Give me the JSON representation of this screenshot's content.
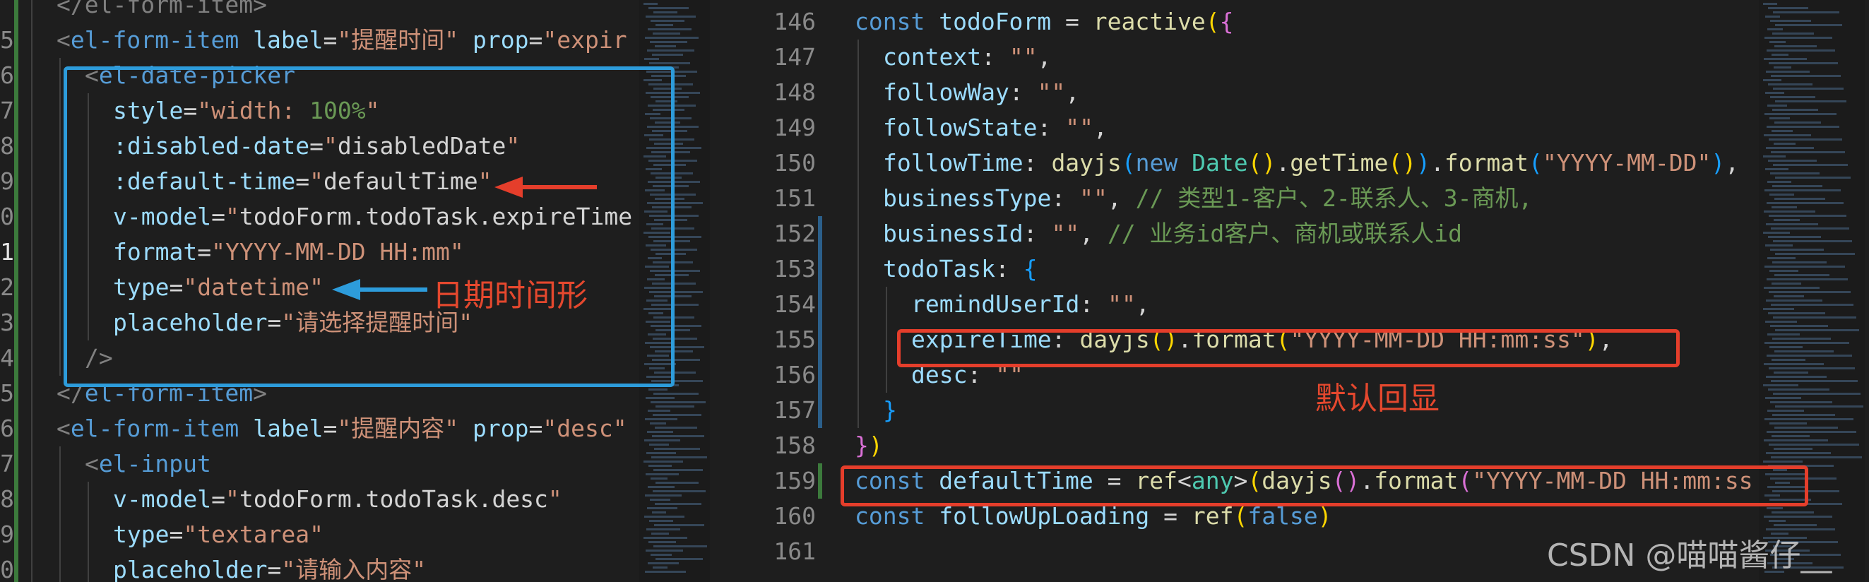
{
  "left_editor": {
    "lines": [
      {
        "num": "",
        "tokens": [
          [
            "t-gray",
            "</el-form-item>"
          ]
        ],
        "indent": 1
      },
      {
        "num": "5",
        "tokens": [
          [
            "t-gray",
            "<"
          ],
          [
            "t-tag",
            "el-form-item"
          ],
          [
            "t-punc",
            " "
          ],
          [
            "t-attr",
            "label"
          ],
          [
            "t-punc",
            "="
          ],
          [
            "t-str",
            "\"提醒时间\""
          ],
          [
            "t-punc",
            " "
          ],
          [
            "t-attr",
            "prop"
          ],
          [
            "t-punc",
            "="
          ],
          [
            "t-str",
            "\"expir"
          ]
        ],
        "indent": 1
      },
      {
        "num": "6",
        "tokens": [
          [
            "t-gray",
            "<"
          ],
          [
            "t-tag",
            "el-date-picker"
          ]
        ],
        "indent": 2
      },
      {
        "num": "7",
        "tokens": [
          [
            "t-attr",
            "style"
          ],
          [
            "t-punc",
            "="
          ],
          [
            "t-str",
            "\"width: "
          ],
          [
            "t-cmt",
            "100%"
          ],
          [
            "t-str",
            "\""
          ]
        ],
        "indent": 3
      },
      {
        "num": "8",
        "tokens": [
          [
            "t-attr",
            ":disabled-date"
          ],
          [
            "t-punc",
            "="
          ],
          [
            "t-str",
            "\""
          ],
          [
            "t-punc",
            "disabledDate"
          ],
          [
            "t-str",
            "\""
          ]
        ],
        "indent": 3
      },
      {
        "num": "9",
        "tokens": [
          [
            "t-attr",
            ":default-time"
          ],
          [
            "t-punc",
            "="
          ],
          [
            "t-str",
            "\""
          ],
          [
            "t-punc",
            "defaultTime"
          ],
          [
            "t-str",
            "\""
          ]
        ],
        "indent": 3
      },
      {
        "num": "0",
        "tokens": [
          [
            "t-attr",
            "v-model"
          ],
          [
            "t-punc",
            "="
          ],
          [
            "t-str",
            "\""
          ],
          [
            "t-punc",
            "todoForm.todoTask.expireTime"
          ]
        ],
        "indent": 3
      },
      {
        "num": "1",
        "tokens": [
          [
            "t-attr",
            "format"
          ],
          [
            "t-punc",
            "="
          ],
          [
            "t-str",
            "\"YYYY-MM-DD HH:mm\""
          ]
        ],
        "indent": 3,
        "active": true
      },
      {
        "num": "2",
        "tokens": [
          [
            "t-attr",
            "type"
          ],
          [
            "t-punc",
            "="
          ],
          [
            "t-str",
            "\"datetime\""
          ]
        ],
        "indent": 3
      },
      {
        "num": "3",
        "tokens": [
          [
            "t-attr",
            "placeholder"
          ],
          [
            "t-punc",
            "="
          ],
          [
            "t-str",
            "\"请选择提醒时间\""
          ]
        ],
        "indent": 3
      },
      {
        "num": "4",
        "tokens": [
          [
            "t-gray",
            "/>"
          ]
        ],
        "indent": 2
      },
      {
        "num": "5",
        "tokens": [
          [
            "t-gray",
            "</"
          ],
          [
            "t-tag",
            "el-form-item"
          ],
          [
            "t-gray",
            ">"
          ]
        ],
        "indent": 1
      },
      {
        "num": "6",
        "tokens": [
          [
            "t-gray",
            "<"
          ],
          [
            "t-tag",
            "el-form-item"
          ],
          [
            "t-punc",
            " "
          ],
          [
            "t-attr",
            "label"
          ],
          [
            "t-punc",
            "="
          ],
          [
            "t-str",
            "\"提醒内容\""
          ],
          [
            "t-punc",
            " "
          ],
          [
            "t-attr",
            "prop"
          ],
          [
            "t-punc",
            "="
          ],
          [
            "t-str",
            "\"desc\""
          ]
        ],
        "indent": 1
      },
      {
        "num": "7",
        "tokens": [
          [
            "t-gray",
            "<"
          ],
          [
            "t-tag",
            "el-input"
          ]
        ],
        "indent": 2
      },
      {
        "num": "8",
        "tokens": [
          [
            "t-attr",
            "v-model"
          ],
          [
            "t-punc",
            "="
          ],
          [
            "t-str",
            "\""
          ],
          [
            "t-punc",
            "todoForm.todoTask.desc"
          ],
          [
            "t-str",
            "\""
          ]
        ],
        "indent": 3
      },
      {
        "num": "9",
        "tokens": [
          [
            "t-attr",
            "type"
          ],
          [
            "t-punc",
            "="
          ],
          [
            "t-str",
            "\"textarea\""
          ]
        ],
        "indent": 3
      },
      {
        "num": "0",
        "tokens": [
          [
            "t-attr",
            "placeholder"
          ],
          [
            "t-punc",
            "="
          ],
          [
            "t-str",
            "\"请输入内容\""
          ]
        ],
        "indent": 3
      }
    ]
  },
  "right_editor": {
    "lines": [
      {
        "num": "146",
        "tokens": [
          [
            "t-kw",
            "const"
          ],
          [
            "t-punc",
            " "
          ],
          [
            "t-var",
            "todoForm"
          ],
          [
            "t-punc",
            " = "
          ],
          [
            "t-fn",
            "reactive"
          ],
          [
            "t-brk1",
            "("
          ],
          [
            "t-brk2",
            "{"
          ]
        ],
        "indent": 0
      },
      {
        "num": "147",
        "tokens": [
          [
            "t-var",
            "context"
          ],
          [
            "t-punc",
            ": "
          ],
          [
            "t-str",
            "\"\""
          ],
          [
            "t-punc",
            ","
          ]
        ],
        "indent": 1
      },
      {
        "num": "148",
        "tokens": [
          [
            "t-var",
            "followWay"
          ],
          [
            "t-punc",
            ": "
          ],
          [
            "t-str",
            "\"\""
          ],
          [
            "t-punc",
            ","
          ]
        ],
        "indent": 1
      },
      {
        "num": "149",
        "tokens": [
          [
            "t-var",
            "followState"
          ],
          [
            "t-punc",
            ": "
          ],
          [
            "t-str",
            "\"\""
          ],
          [
            "t-punc",
            ","
          ]
        ],
        "indent": 1
      },
      {
        "num": "150",
        "tokens": [
          [
            "t-var",
            "followTime"
          ],
          [
            "t-punc",
            ": "
          ],
          [
            "t-fn",
            "dayjs"
          ],
          [
            "t-brk3",
            "("
          ],
          [
            "t-kw",
            "new"
          ],
          [
            "t-punc",
            " "
          ],
          [
            "t-type",
            "Date"
          ],
          [
            "t-brk1",
            "()"
          ],
          [
            "t-punc",
            "."
          ],
          [
            "t-fn",
            "getTime"
          ],
          [
            "t-brk1",
            "()"
          ],
          [
            "t-brk3",
            ")"
          ],
          [
            "t-punc",
            "."
          ],
          [
            "t-fn",
            "format"
          ],
          [
            "t-brk3",
            "("
          ],
          [
            "t-str",
            "\"YYYY-MM-DD\""
          ],
          [
            "t-brk3",
            ")"
          ],
          [
            "t-punc",
            ","
          ]
        ],
        "indent": 1
      },
      {
        "num": "151",
        "tokens": [
          [
            "t-var",
            "businessType"
          ],
          [
            "t-punc",
            ": "
          ],
          [
            "t-str",
            "\"\""
          ],
          [
            "t-punc",
            ", "
          ],
          [
            "t-cmt",
            "// 类型1-客户、2-联系人、3-商机,"
          ]
        ],
        "indent": 1
      },
      {
        "num": "152",
        "tokens": [
          [
            "t-var",
            "businessId"
          ],
          [
            "t-punc",
            ": "
          ],
          [
            "t-str",
            "\"\""
          ],
          [
            "t-punc",
            ", "
          ],
          [
            "t-cmt",
            "// 业务id客户、商机或联系人id"
          ]
        ],
        "indent": 1
      },
      {
        "num": "153",
        "tokens": [
          [
            "t-var",
            "todoTask"
          ],
          [
            "t-punc",
            ": "
          ],
          [
            "t-brk3",
            "{"
          ]
        ],
        "indent": 1
      },
      {
        "num": "154",
        "tokens": [
          [
            "t-var",
            "remindUserId"
          ],
          [
            "t-punc",
            ": "
          ],
          [
            "t-str",
            "\"\""
          ],
          [
            "t-punc",
            ","
          ]
        ],
        "indent": 2
      },
      {
        "num": "155",
        "tokens": [
          [
            "t-var",
            "expireTime"
          ],
          [
            "t-punc",
            ": "
          ],
          [
            "t-fn",
            "dayjs"
          ],
          [
            "t-brk1",
            "()"
          ],
          [
            "t-punc",
            "."
          ],
          [
            "t-fn",
            "format"
          ],
          [
            "t-brk1",
            "("
          ],
          [
            "t-str",
            "\"YYYY-MM-DD HH:mm:ss\""
          ],
          [
            "t-brk1",
            ")"
          ],
          [
            "t-punc",
            ","
          ]
        ],
        "indent": 2
      },
      {
        "num": "156",
        "tokens": [
          [
            "t-var",
            "desc"
          ],
          [
            "t-punc",
            ": "
          ],
          [
            "t-str",
            "\"\""
          ]
        ],
        "indent": 2
      },
      {
        "num": "157",
        "tokens": [
          [
            "t-brk3",
            "}"
          ]
        ],
        "indent": 1
      },
      {
        "num": "158",
        "tokens": [
          [
            "t-brk2",
            "}"
          ],
          [
            "t-brk1",
            ")"
          ]
        ],
        "indent": 0
      },
      {
        "num": "159",
        "tokens": [
          [
            "t-kw",
            "const"
          ],
          [
            "t-punc",
            " "
          ],
          [
            "t-var",
            "defaultTime"
          ],
          [
            "t-punc",
            " = "
          ],
          [
            "t-fn",
            "ref"
          ],
          [
            "t-punc",
            "<"
          ],
          [
            "t-type",
            "any"
          ],
          [
            "t-punc",
            ">"
          ],
          [
            "t-brk1",
            "("
          ],
          [
            "t-fn",
            "dayjs"
          ],
          [
            "t-brk2",
            "()"
          ],
          [
            "t-punc",
            "."
          ],
          [
            "t-fn",
            "format"
          ],
          [
            "t-brk2",
            "("
          ],
          [
            "t-str",
            "\"YYYY-MM-DD HH:mm:ss"
          ]
        ],
        "indent": 0
      },
      {
        "num": "160",
        "tokens": [
          [
            "t-kw",
            "const"
          ],
          [
            "t-punc",
            " "
          ],
          [
            "t-var",
            "followUpLoading"
          ],
          [
            "t-punc",
            " = "
          ],
          [
            "t-fn",
            "ref"
          ],
          [
            "t-brk1",
            "("
          ],
          [
            "t-kw",
            "false"
          ],
          [
            "t-brk1",
            ")"
          ]
        ],
        "indent": 0
      },
      {
        "num": "161",
        "tokens": [],
        "indent": 0
      }
    ]
  },
  "annotations": {
    "datetime_label": "日期时间形",
    "default_echo_label": "默认回显",
    "watermark": "CSDN @喵喵酱仔__"
  },
  "colors": {
    "blue_box": "#2d9cdb",
    "red_box": "#e53e2b",
    "arrow_red": "#e53e2b",
    "arrow_blue": "#2d9cdb"
  }
}
